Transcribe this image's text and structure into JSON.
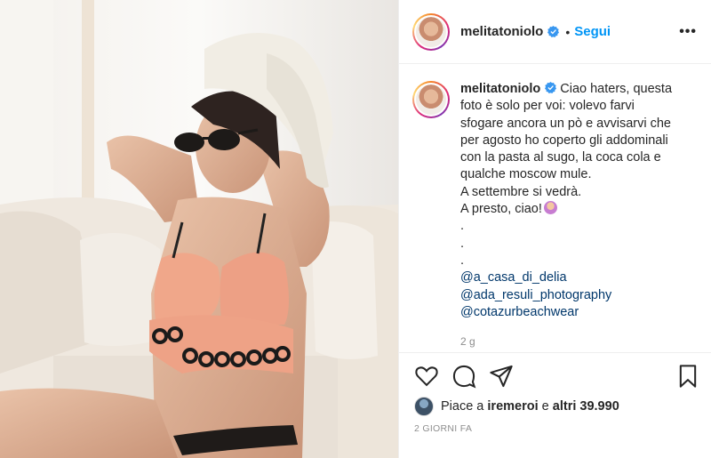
{
  "post": {
    "username": "melitatoniolo",
    "follow_label": "Segui",
    "separator": "•",
    "more_label": "•••",
    "caption_lines": [
      "Ciao haters, questa",
      "foto è solo per voi: volevo farvi",
      "sfogare ancora un pò e avvisarvi che",
      "per agosto ho coperto gli addominali",
      "con la pasta al sugo, la coca cola e",
      "qualche moscow mule.",
      "A settembre si vedrà.",
      "A presto, ciao!"
    ],
    "dots": [
      ".",
      ".",
      "."
    ],
    "tags": [
      "@a_casa_di_delia",
      "@ada_resuli_photography",
      "@cotazurbeachwear"
    ],
    "time_ago": "2 g",
    "likes_prefix": "Piace a",
    "likes_user": "iremeroi",
    "likes_middle": "e",
    "likes_others": "altri 39.990",
    "date": "2 GIORNI FA"
  },
  "icons": {
    "like": "heart-icon",
    "comment": "comment-icon",
    "share": "paper-plane-icon",
    "save": "bookmark-icon",
    "verified": "verified-badge-icon"
  },
  "colors": {
    "accent": "#0095f6",
    "tag": "#00376b",
    "muted": "#8e8e8e",
    "text": "#262626"
  }
}
